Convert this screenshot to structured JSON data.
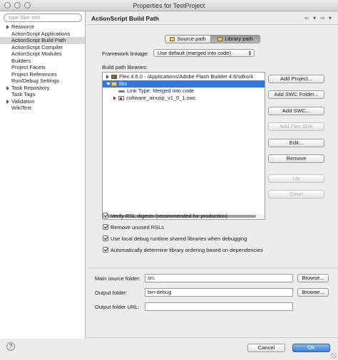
{
  "window": {
    "title": "Properties for TestProject"
  },
  "sidebar": {
    "filter_placeholder": "type filter text",
    "items": [
      {
        "label": "Resource",
        "expandable": true
      },
      {
        "label": "ActionScript Applications",
        "expandable": false
      },
      {
        "label": "ActionScript Build Path",
        "expandable": false,
        "selected": true
      },
      {
        "label": "ActionScript Compiler",
        "expandable": false
      },
      {
        "label": "ActionScript Modules",
        "expandable": false
      },
      {
        "label": "Builders",
        "expandable": false
      },
      {
        "label": "Project Facets",
        "expandable": false
      },
      {
        "label": "Project References",
        "expandable": false
      },
      {
        "label": "Run/Debug Settings",
        "expandable": false
      },
      {
        "label": "Task Repository",
        "expandable": true
      },
      {
        "label": "Task Tags",
        "expandable": false
      },
      {
        "label": "Validation",
        "expandable": true
      },
      {
        "label": "WikiText",
        "expandable": false
      }
    ]
  },
  "page": {
    "title": "ActionScript Build Path",
    "tabs": [
      {
        "label": "Source path",
        "active": false
      },
      {
        "label": "Library path",
        "active": true
      }
    ],
    "framework_linkage_label": "Framework linkage:",
    "framework_linkage_value": "Use default (merged into code)",
    "build_path_libraries_label": "Build path libraries:",
    "libraries": [
      {
        "label": "Flex 4.6.0 - /Applications/Adobe Flash Builder 4.6/sdks/4",
        "icon": "flex-sdk-icon",
        "state": "collapsed"
      },
      {
        "label": "libs",
        "icon": "folder-icon",
        "state": "expanded",
        "selected": true
      },
      {
        "label": "Link Type: Merged into code",
        "icon": "link-icon",
        "state": "none"
      },
      {
        "label": "coltware_airxzip_v1_0_1.swc",
        "icon": "swc-file-icon",
        "state": "collapsed"
      }
    ],
    "buttons": {
      "add_project": "Add Project...",
      "add_swc_folder": "Add SWC Folder...",
      "add_swc": "Add SWC...",
      "add_flex_sdk": "Add Flex SDK",
      "edit": "Edit...",
      "remove": "Remove",
      "up": "Up",
      "down": "Down"
    },
    "checkboxes": [
      {
        "label": "Verify RSL digests (recommended for production)",
        "checked": true
      },
      {
        "label": "Remove unused RSLs",
        "checked": true
      },
      {
        "label": "Use local debug runtime shared libraries when debugging",
        "checked": true
      },
      {
        "label": "Automatically determine library ordering based on dependencies",
        "checked": true
      }
    ],
    "main_source_folder_label": "Main source folder:",
    "main_source_folder_value": "src",
    "output_folder_label": "Output folder:",
    "output_folder_value": "bin-debug",
    "output_folder_url_label": "Output folder URL:",
    "output_folder_url_value": "",
    "browse_label": "Browse..."
  },
  "footer": {
    "help": "?",
    "cancel": "Cancel",
    "ok": "OK"
  }
}
